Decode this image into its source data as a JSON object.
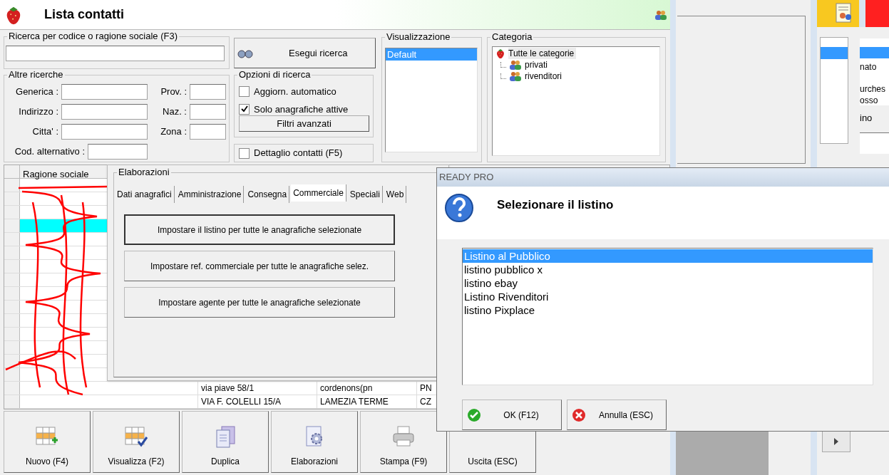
{
  "window": {
    "title": "Lista contatti"
  },
  "search": {
    "legend": "Ricerca per codice o ragione sociale (F3)",
    "button": "Esegui ricerca"
  },
  "other_searches": {
    "legend": "Altre ricerche",
    "left_fields": [
      {
        "label": "Generica :"
      },
      {
        "label": "Indirizzo :"
      },
      {
        "label": "Citta' :"
      }
    ],
    "alt_field": {
      "label": "Cod. alternativo :"
    },
    "right_fields": [
      {
        "label": "Prov. :"
      },
      {
        "label": "Naz. :"
      },
      {
        "label": "Zona :"
      }
    ]
  },
  "search_options": {
    "legend": "Opzioni di ricerca",
    "options": [
      {
        "label": "Aggiorn. automatico",
        "checked": false
      },
      {
        "label": "Solo anagrafiche attive",
        "checked": true
      }
    ],
    "button": "Filtri avanzati"
  },
  "contact_detail": {
    "label": "Dettaglio contatti (F5)",
    "checked": false
  },
  "view": {
    "legend": "Visualizzazione",
    "items": [
      {
        "label": "Default",
        "selected": true
      }
    ]
  },
  "category": {
    "legend": "Categoria",
    "tree": {
      "label": "Tutte le categorie",
      "selected": true,
      "children": [
        {
          "label": "privati",
          "selected": false
        },
        {
          "label": "rivenditori",
          "selected": false
        }
      ]
    }
  },
  "table": {
    "columns": [
      "Ragione sociale"
    ],
    "rows": [
      {
        "selected": false
      },
      {
        "selected": false
      },
      {
        "selected": false
      },
      {
        "selected": true
      },
      {
        "selected": false
      },
      {
        "selected": false
      },
      {
        "selected": false
      },
      {
        "selected": false
      },
      {
        "selected": false
      },
      {
        "selected": false
      },
      {
        "selected": false
      },
      {
        "selected": false
      },
      {
        "selected": false
      },
      {
        "selected": false
      },
      {
        "selected": false
      },
      {
        "selected": false,
        "cells": [
          "via piave 58/1",
          "cordenons(pn",
          "PN"
        ]
      },
      {
        "selected": false,
        "cells": [
          "VIA F. COLELLI 15/A",
          "LAMEZIA TERME",
          "CZ"
        ]
      }
    ]
  },
  "processing": {
    "legend": "Elaborazioni",
    "tabs": [
      {
        "label": "Dati anagrafici",
        "selected": false
      },
      {
        "label": "Amministrazione",
        "selected": false
      },
      {
        "label": "Consegna",
        "selected": false
      },
      {
        "label": "Commerciale",
        "selected": true
      },
      {
        "label": "Speciali",
        "selected": false
      },
      {
        "label": "Web",
        "selected": false
      }
    ],
    "buttons": [
      "Impostare il listino per tutte le anagrafiche selezionate",
      "Impostare ref. commerciale per tutte le anagrafiche selez.",
      "Impostare agente per tutte le anagrafiche selezionate"
    ]
  },
  "toolbar": [
    {
      "label": "Nuovo (F4)",
      "kind": "new"
    },
    {
      "label": "Visualizza (F2)",
      "kind": "view"
    },
    {
      "label": "Duplica",
      "kind": "copy"
    },
    {
      "label": "Elaborazioni",
      "kind": "process"
    },
    {
      "label": "Stampa (F9)",
      "kind": "print"
    },
    {
      "label": "Uscita (ESC)",
      "kind": "exit"
    }
  ],
  "background_window": {
    "texts": [
      "nato",
      "urches",
      "osso",
      "ino"
    ]
  },
  "dialog": {
    "title": "READY PRO",
    "message": "Selezionare il listino",
    "items": [
      {
        "label": "Listino al Pubblico",
        "selected": true
      },
      {
        "label": "listino pubblico x",
        "selected": false
      },
      {
        "label": "listino ebay",
        "selected": false
      },
      {
        "label": "Listino Rivenditori",
        "selected": false
      },
      {
        "label": "listino Pixplace",
        "selected": false
      }
    ],
    "buttons": [
      {
        "label": "OK (F12)",
        "kind": "ok"
      },
      {
        "label": "Annulla (ESC)",
        "kind": "cancel"
      }
    ]
  }
}
